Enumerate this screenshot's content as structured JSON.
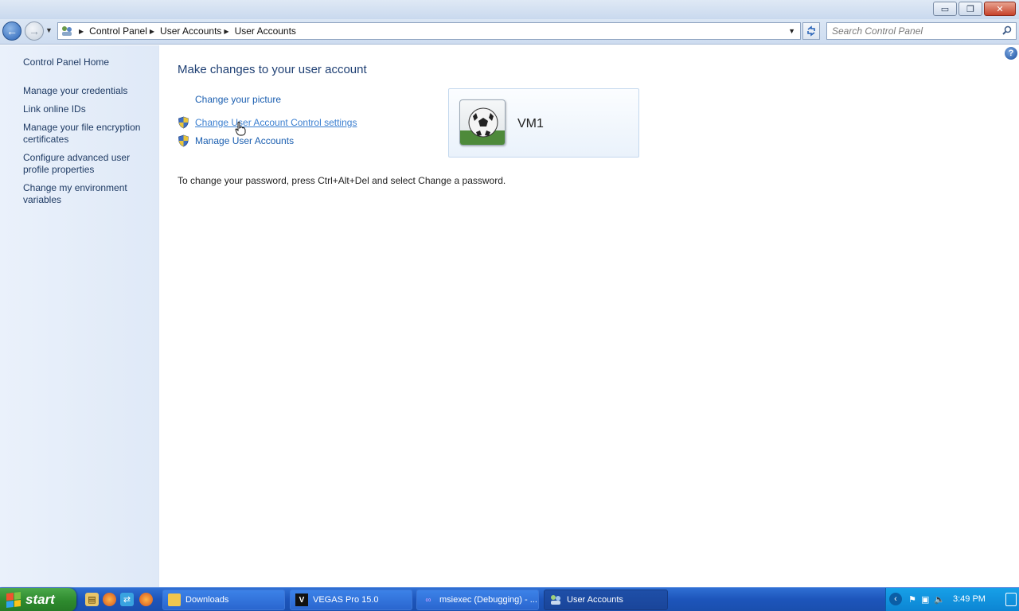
{
  "window": {
    "minimize_label": "▭",
    "maximize_label": "❐",
    "close_label": "✕"
  },
  "address_bar": {
    "breadcrumbs": [
      "Control Panel",
      "User Accounts",
      "User Accounts"
    ],
    "search_placeholder": "Search Control Panel"
  },
  "sidebar": {
    "items": [
      {
        "label": "Control Panel Home"
      },
      {
        "label": "Manage your credentials"
      },
      {
        "label": "Link online IDs"
      },
      {
        "label": "Manage your file encryption certificates"
      },
      {
        "label": "Configure advanced user profile properties"
      },
      {
        "label": "Change my environment variables"
      }
    ]
  },
  "main": {
    "heading": "Make changes to your user account",
    "tasks": [
      {
        "label": "Change your picture"
      },
      {
        "label": "Change User Account Control settings"
      },
      {
        "label": "Manage User Accounts"
      }
    ],
    "account_name": "VM1",
    "password_note": "To change your password, press Ctrl+Alt+Del and select Change a password."
  },
  "taskbar": {
    "start_label": "start",
    "buttons": [
      {
        "label": "Downloads"
      },
      {
        "label": "VEGAS Pro 15.0"
      },
      {
        "label": "msiexec (Debugging) - ..."
      },
      {
        "label": "User Accounts"
      }
    ],
    "clock": "3:49 PM"
  },
  "colors": {
    "link": "#1a5eb0",
    "heading": "#1e3f73",
    "taskbar": "#1d55bb",
    "start": "#2e8a2e"
  }
}
